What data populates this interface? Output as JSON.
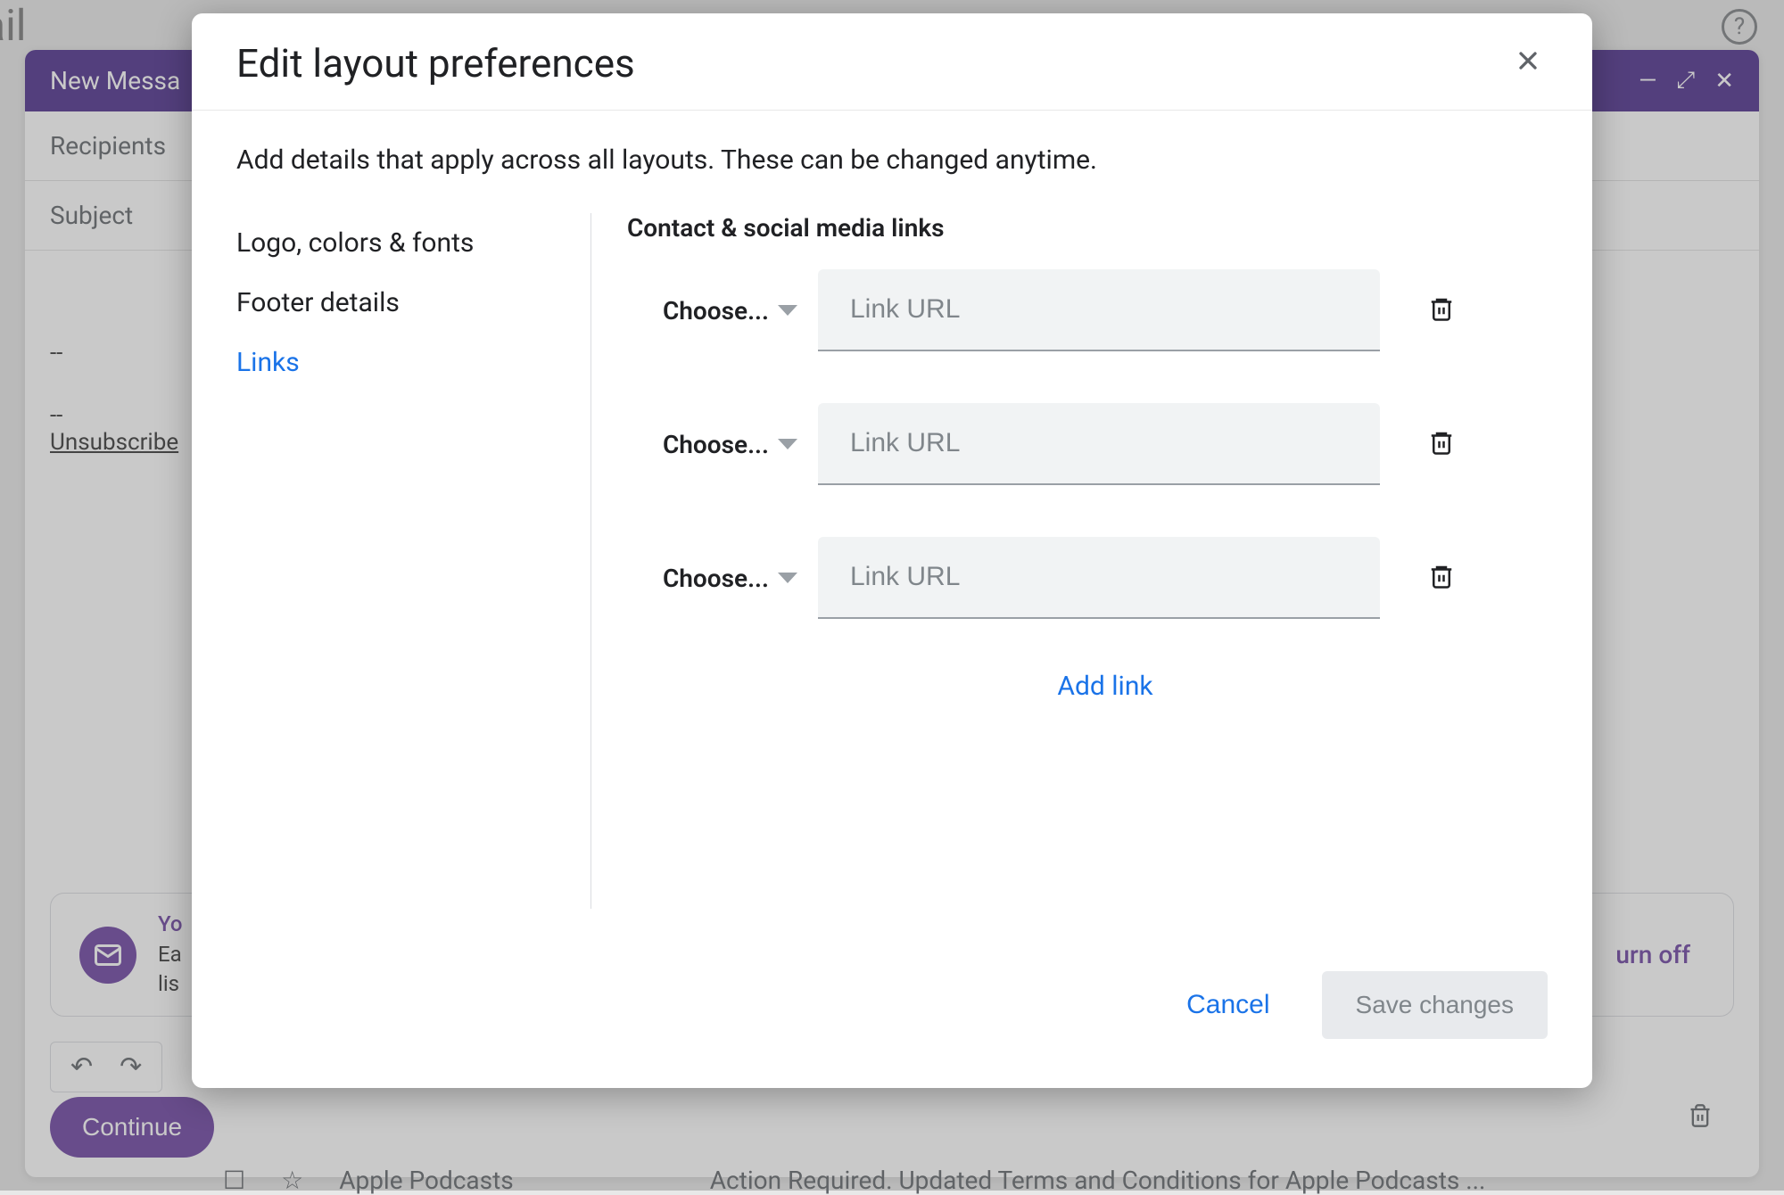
{
  "background": {
    "mail_text": "ail",
    "compose_title": "New Messa",
    "recipients_label": "Recipients",
    "subject_label": "Subject",
    "signature_1": "--",
    "signature_2": "--",
    "unsubscribe": "Unsubscribe",
    "banner_title_partial": "Yo",
    "banner_line1": "Ea",
    "banner_line2": "lis",
    "turn_off": "urn off",
    "continue": "Continue",
    "bottom_sender": "Apple Podcasts",
    "bottom_subject": "Action Required. Updated Terms and Conditions for Apple Podcasts ..."
  },
  "modal": {
    "title": "Edit layout preferences",
    "subtitle": "Add details that apply across all layouts. These can be changed anytime.",
    "sidebar": {
      "item1": "Logo, colors & fonts",
      "item2": "Footer details",
      "item3": "Links"
    },
    "section_title": "Contact & social media links",
    "link_rows": [
      {
        "choose_label": "Choose...",
        "placeholder": "Link URL"
      },
      {
        "choose_label": "Choose...",
        "placeholder": "Link URL"
      },
      {
        "choose_label": "Choose...",
        "placeholder": "Link URL"
      }
    ],
    "add_link": "Add link",
    "cancel": "Cancel",
    "save": "Save changes"
  }
}
